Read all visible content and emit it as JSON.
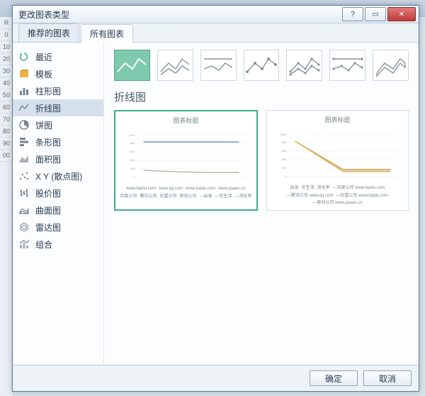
{
  "window": {
    "title": "更改图表类型",
    "close_label": "✕",
    "min_label": "?",
    "max_label": "▭"
  },
  "tabs": {
    "recommended": "推荐的图表",
    "all": "所有图表"
  },
  "categories": [
    {
      "key": "recent",
      "label": "最近"
    },
    {
      "key": "template",
      "label": "模板"
    },
    {
      "key": "column",
      "label": "柱形图"
    },
    {
      "key": "line",
      "label": "折线图"
    },
    {
      "key": "pie",
      "label": "饼图"
    },
    {
      "key": "bar",
      "label": "条形图"
    },
    {
      "key": "area",
      "label": "面积图"
    },
    {
      "key": "scatter",
      "label": "X Y (散点图)"
    },
    {
      "key": "stock",
      "label": "股价图"
    },
    {
      "key": "surface",
      "label": "曲面图"
    },
    {
      "key": "radar",
      "label": "雷达图"
    },
    {
      "key": "combo",
      "label": "组合"
    }
  ],
  "selected_category_index": 3,
  "section_title": "折线图",
  "preview_title": "图表标题",
  "preview_legend_a": [
    "www.baidu.com",
    "www.qq.com",
    "www.baidu.com",
    "www.yaaan.cn",
    "百度公司",
    "腾讯公司",
    "优富公司",
    "原创公司",
    "―出身",
    "―优生活",
    "―消化率"
  ],
  "preview_legend_b": [
    "出身",
    "优生活",
    "消化率",
    "―百度公司 www.baidu.com",
    "―腾讯公司 www.qq.com",
    "―优富公司 www.baidu.com",
    "―原创公司 www.yaaan.cn"
  ],
  "footer": {
    "ok": "确定",
    "cancel": "取消"
  },
  "row_headers": [
    "R",
    "0",
    "10",
    "20",
    "30",
    "40",
    "50",
    "60",
    "70",
    "80",
    "90",
    "00"
  ],
  "chart_data": {
    "type": "line",
    "preview_1": {
      "title": "图表标题",
      "x_groups": [
        "百度公司 www.baidu.com",
        "腾讯公司 www.qq.com",
        "优富公司 www.baidu.com",
        "原创公司 www.yaaan.cn"
      ],
      "series": [
        {
          "name": "出身",
          "values": [
            1000,
            1000,
            1000,
            1000
          ],
          "color": "#4e88c7"
        },
        {
          "name": "优生活",
          "values": [
            200,
            180,
            170,
            170
          ],
          "color": "#d99b3a"
        },
        {
          "name": "消化率",
          "values": [
            200,
            180,
            170,
            170
          ],
          "color": "#b7b7b7"
        }
      ],
      "ylim": [
        0,
        1200
      ],
      "yticks": [
        0,
        200,
        400,
        600,
        800,
        1000,
        1200
      ]
    },
    "preview_2": {
      "title": "图表标题",
      "x_categories": [
        "出身",
        "优生活",
        "消化率"
      ],
      "series": [
        {
          "name": "百度公司 www.baidu.com",
          "values": [
            1000,
            200,
            200
          ],
          "color": "#d99b3a"
        },
        {
          "name": "腾讯公司 www.qq.com",
          "values": [
            1000,
            180,
            180
          ],
          "color": "#b7b7b7"
        },
        {
          "name": "优富公司 www.baidu.com",
          "values": [
            1000,
            170,
            170
          ],
          "color": "#d9c23a"
        },
        {
          "name": "原创公司 www.yaaan.cn",
          "values": [
            1000,
            170,
            170
          ],
          "color": "#6fa8dc"
        }
      ],
      "ylim": [
        0,
        1200
      ],
      "yticks": [
        0,
        200,
        400,
        600,
        800,
        1000,
        1200
      ]
    }
  }
}
